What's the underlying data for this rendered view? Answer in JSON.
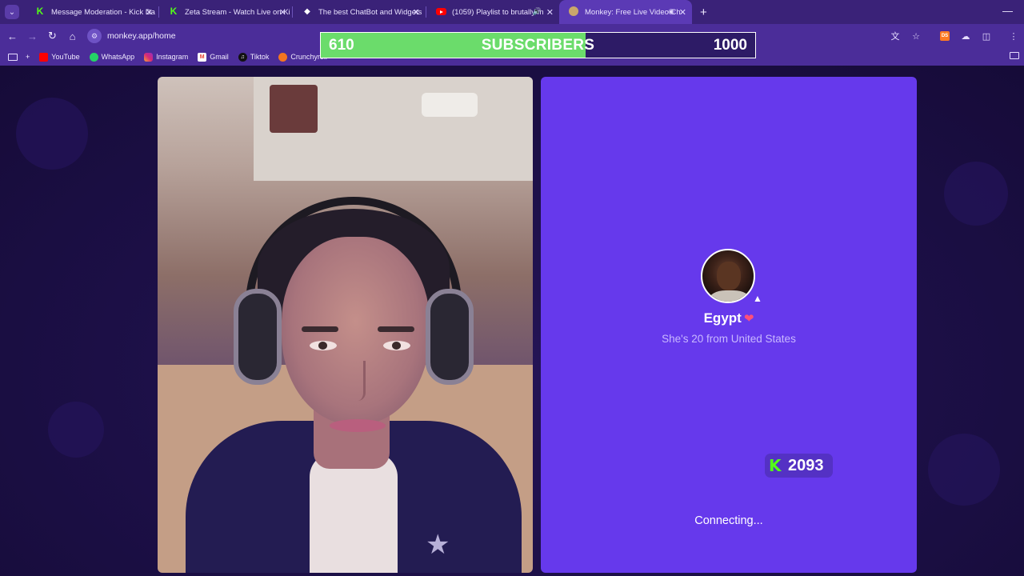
{
  "browser": {
    "tabs": [
      {
        "title": "Message Moderation - Kick Da",
        "favicon": "kick-icon",
        "active": false
      },
      {
        "title": "Zeta Stream - Watch Live on Ki",
        "favicon": "kick-icon",
        "active": false
      },
      {
        "title": "The best ChatBot and Widgets",
        "favicon": "diamond-icon",
        "active": false
      },
      {
        "title": "(1059) Playlist to brutally m",
        "favicon": "youtube-icon",
        "active": false
      },
      {
        "title": "Monkey: Free Live Video Ch",
        "favicon": "monkey-icon",
        "active": true
      }
    ],
    "url": "monkey.app/home",
    "bookmarks": [
      "YouTube",
      "WhatsApp",
      "Instagram",
      "Gmail",
      "Tiktok",
      "Crunchyroll"
    ]
  },
  "overlay": {
    "current": "610",
    "label": "SUBSCRIBERS",
    "goal": "1000",
    "progress": 0.61,
    "fill_color": "#6bdc6b"
  },
  "match": {
    "name": "Egypt",
    "subtitle": "She's 20 from United States",
    "status": "Connecting...",
    "panel_color": "#6639ec"
  },
  "kick_badge": {
    "count": "2093",
    "brand_color": "#53fc18"
  }
}
